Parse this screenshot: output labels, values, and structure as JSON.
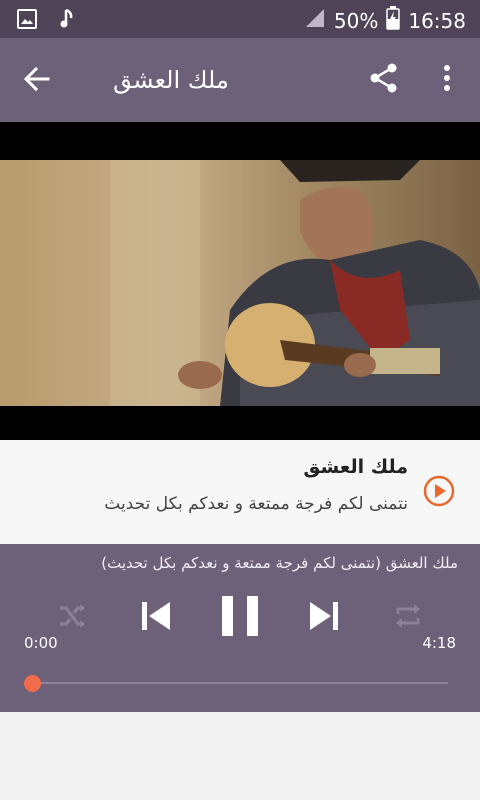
{
  "status_bar": {
    "battery": "50%",
    "time": "16:58",
    "icons": [
      "image-icon",
      "music-note-icon",
      "signal-icon",
      "battery-charging-icon"
    ]
  },
  "app_bar": {
    "title": "ملك العشق",
    "icons": [
      "back-arrow-icon",
      "share-icon",
      "more-vert-icon"
    ]
  },
  "track": {
    "title": "ملك العشق",
    "subtitle": "نتمنى لكم فرجة ممتعة و نعدكم بكل تحديث"
  },
  "player": {
    "now_playing": "ملك العشق (نتمنى لكم فرجة ممتعة و نعدكم بكل تحديث)",
    "elapsed": "0:00",
    "duration": "4:18",
    "progress": 0,
    "accent_color": "#f26b4a"
  }
}
